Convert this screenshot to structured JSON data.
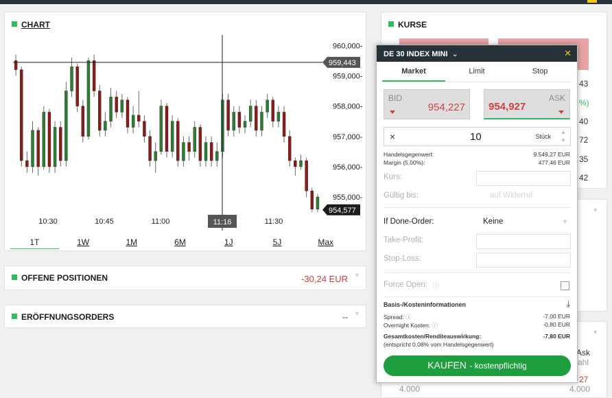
{
  "chart": {
    "title": "CHART",
    "price_ticks": [
      "960,000-",
      "959,000-",
      "958,000-",
      "957,000-",
      "956,000-",
      "955,000-"
    ],
    "time_ticks": [
      "10:30",
      "10:45",
      "11:00",
      "11:16",
      "11:30"
    ],
    "crosshair_label": "959,443",
    "crosshair_time": "11:16",
    "last_price": "954,577",
    "timeframes": [
      "1T",
      "1W",
      "1M",
      "6M",
      "1J",
      "5J",
      "Max"
    ],
    "colors": {
      "up": "#2e7d32",
      "down": "#8b1a1a",
      "axis_tag": "#555555",
      "last": "#1c1c1c"
    }
  },
  "chart_data": {
    "type": "candlestick",
    "title": "",
    "yticks": [
      "960,000",
      "959,000",
      "958,000",
      "957,000",
      "956,000",
      "955,000"
    ],
    "xticks": [
      "10:30",
      "10:45",
      "11:00",
      "11:30"
    ],
    "ylim": [
      954.3,
      960.3
    ],
    "crosshair": {
      "price": 959.443,
      "time": "11:16"
    },
    "last": 954.577,
    "candles": [
      [
        959.5,
        959.2,
        959.7,
        959.0
      ],
      [
        959.2,
        956.2,
        959.3,
        956.0
      ],
      [
        956.2,
        956.0,
        956.5,
        955.8
      ],
      [
        956.0,
        957.2,
        957.5,
        955.8
      ],
      [
        957.2,
        956.0,
        957.3,
        955.7
      ],
      [
        956.0,
        957.8,
        958.0,
        955.9
      ],
      [
        957.8,
        956.0,
        957.9,
        955.8
      ],
      [
        956.0,
        957.3,
        957.5,
        955.8
      ],
      [
        957.3,
        956.2,
        957.5,
        956.0
      ],
      [
        956.2,
        958.5,
        958.8,
        956.0
      ],
      [
        958.5,
        959.3,
        959.6,
        958.3
      ],
      [
        959.3,
        958.0,
        959.4,
        957.8
      ],
      [
        958.0,
        957.0,
        958.2,
        956.8
      ],
      [
        957.0,
        959.5,
        959.6,
        956.9
      ],
      [
        959.5,
        958.5,
        959.7,
        958.3
      ],
      [
        958.5,
        957.2,
        958.7,
        957.0
      ],
      [
        957.2,
        957.5,
        957.8,
        957.0
      ],
      [
        957.5,
        958.3,
        958.6,
        957.3
      ],
      [
        958.3,
        957.8,
        958.5,
        957.6
      ],
      [
        957.8,
        958.2,
        958.4,
        957.6
      ],
      [
        958.2,
        957.3,
        958.3,
        957.1
      ],
      [
        957.3,
        957.7,
        958.0,
        957.1
      ],
      [
        957.7,
        957.5,
        958.5,
        957.3
      ],
      [
        957.5,
        957.0,
        957.7,
        956.8
      ],
      [
        957.0,
        956.2,
        957.2,
        956.0
      ],
      [
        956.2,
        956.5,
        956.8,
        955.8
      ],
      [
        956.5,
        958.0,
        958.2,
        956.4
      ],
      [
        958.0,
        956.5,
        958.1,
        956.3
      ],
      [
        956.5,
        957.5,
        957.7,
        956.3
      ],
      [
        957.5,
        956.2,
        957.6,
        956.0
      ],
      [
        956.2,
        956.8,
        957.0,
        956.0
      ],
      [
        956.8,
        956.5,
        957.0,
        956.2
      ],
      [
        956.5,
        957.3,
        957.5,
        956.3
      ],
      [
        957.3,
        956.2,
        957.4,
        956.0
      ],
      [
        956.2,
        956.8,
        957.0,
        956.0
      ],
      [
        956.8,
        956.2,
        957.0,
        956.0
      ],
      [
        956.2,
        956.5,
        956.8,
        956.0
      ],
      [
        956.5,
        958.2,
        958.4,
        956.3
      ],
      [
        958.2,
        957.2,
        958.4,
        957.0
      ],
      [
        957.2,
        957.8,
        958.0,
        957.0
      ],
      [
        957.8,
        957.3,
        958.0,
        957.1
      ],
      [
        957.3,
        957.5,
        957.7,
        957.1
      ],
      [
        957.5,
        958.0,
        958.2,
        957.3
      ],
      [
        958.0,
        957.2,
        958.2,
        957.0
      ],
      [
        957.2,
        957.8,
        958.0,
        957.0
      ],
      [
        957.8,
        958.2,
        958.4,
        957.6
      ],
      [
        958.2,
        957.5,
        958.3,
        957.3
      ],
      [
        957.5,
        957.8,
        958.0,
        957.3
      ],
      [
        957.8,
        957.0,
        958.0,
        956.8
      ],
      [
        957.0,
        956.2,
        957.2,
        956.0
      ],
      [
        956.2,
        956.0,
        956.3,
        955.7
      ],
      [
        956.0,
        956.2,
        956.4,
        955.9
      ],
      [
        956.2,
        955.2,
        956.3,
        955.0
      ],
      [
        955.2,
        954.6,
        955.3,
        954.5
      ],
      [
        954.6,
        955.0,
        955.1,
        954.5
      ]
    ]
  },
  "positions": {
    "title": "OFFENE POSITIONEN",
    "value": "-30,24 EUR"
  },
  "orders": {
    "title": "ERÖFFNUNGSORDERS",
    "value": "--"
  },
  "kurse": {
    "title": "KURSE",
    "side_values": [
      "43",
      "%)",
      "40",
      "72",
      "35",
      "42"
    ],
    "bottom": {
      "ask": "Ask",
      "zahl": "ahl",
      "price": "27",
      "qty": "4.000"
    }
  },
  "ticket": {
    "instrument": "DE 30 INDEX MINI",
    "close": "✕",
    "tabs": [
      "Market",
      "Limit",
      "Stop"
    ],
    "bid_label": "BID",
    "bid": "954,227",
    "ask_label": "ASK",
    "ask": "954,927",
    "qty_x": "×",
    "qty": "10",
    "unit": "Stück",
    "trade_value_label": "Handelsgegenwert:",
    "trade_value": "9.549,27 EUR",
    "margin_label": "Margin (5,00%):",
    "margin": "477,46 EUR",
    "kurs_label": "Kurs:",
    "valid_label": "Gültig bis:",
    "valid_placeholder": "auf Widerruf",
    "ifdone_label": "If Done-Order:",
    "ifdone_value": "Keine",
    "tp_label": "Take-Profit:",
    "sl_label": "Stop-Loss:",
    "force_label": "Force Open:",
    "basis_title": "Basis-/Kosteninformationen",
    "spread_label": "Spread:",
    "spread": "-7,00 EUR",
    "overnight_label": "Overnight Kosten:",
    "overnight": "-0,80 EUR",
    "total_label": "Gesamtkosten/Renditeauswirkung:",
    "total": "-7,80 EUR",
    "total_note": "(entspricht 0,08% vom Handelsgegenwert)",
    "buy_label": "KAUFEN",
    "buy_sub": "- kostenpflichtig"
  }
}
